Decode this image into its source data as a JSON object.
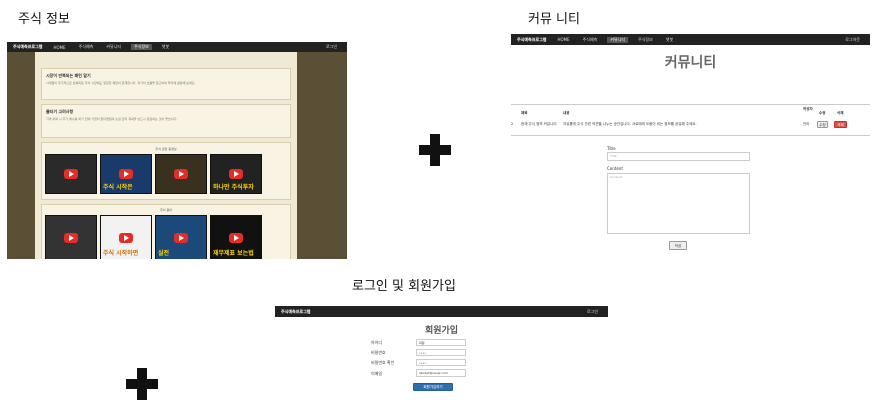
{
  "captions": {
    "stock": "주식 정보",
    "community": "커뮤 니티",
    "login": "로그인 및 회원가입"
  },
  "stock_panel": {
    "brand": "주식예측프로그램",
    "nav": [
      "HOME",
      "주식예측",
      "커뮤니티",
      "주식정보",
      "챗봇"
    ],
    "nav_active_index": 3,
    "nav_right": "로그인",
    "cards": [
      {
        "title": "시장이 반복되는 패턴 알기",
        "body": "사계절이 주기적으로 반복되듯 주식 시장에도 일정한 패턴이 존재합니다. 과거의 흐름을 참고하여 투자에 활용해 보세요."
      },
      {
        "title": "물타기 고려사항",
        "body": "가격 하락 시 추가 매수를 하기 전에 기업의 펀더멘털과 손실 관리 계획을 반드시 점검하는 것이 좋습니다."
      }
    ],
    "video_section_1": "주식 관련 동영상",
    "video_section_2": "주식 용어",
    "thumbs_row1": [
      "",
      "주식 시작은",
      "",
      "하나만 주식투자",
      ""
    ],
    "thumbs_row2": [
      "",
      "주식 시작하면",
      "실전",
      "재무제표 보는법"
    ]
  },
  "community_panel": {
    "brand": "주식예측프로그램",
    "nav": [
      "HOME",
      "주식예측",
      "커뮤니티",
      "주식정보",
      "챗봇"
    ],
    "nav_active_index": 2,
    "nav_right": "로그아웃",
    "title": "커뮤니티",
    "table_headers": [
      "제목",
      "내용",
      "작성자",
      "수정",
      "삭제"
    ],
    "row": {
      "no": "2",
      "title": "현재 주식 정보 커뮤니티",
      "content": "자유롭게 주식 관련 의견을 나누는 공간입니다. 서로에게 도움이 되는 정보를 공유해 주세요.",
      "author": "관리",
      "edit": "수정",
      "delete": "삭제"
    },
    "title_label": "Title",
    "title_placeholder": "Title",
    "content_label": "Content",
    "content_placeholder": "Content",
    "submit": "작성"
  },
  "login_panel": {
    "brand": "주식예측프로그램",
    "nav_right": "로그인",
    "title": "회원가입",
    "fields": [
      {
        "label": "아이디",
        "value": "회원"
      },
      {
        "label": "비밀번호",
        "value": "••••"
      },
      {
        "label": "비밀번호 확인",
        "value": "••••"
      },
      {
        "label": "이메일",
        "value": "abcdef@naver.com"
      }
    ],
    "submit": "회원가입하기"
  }
}
